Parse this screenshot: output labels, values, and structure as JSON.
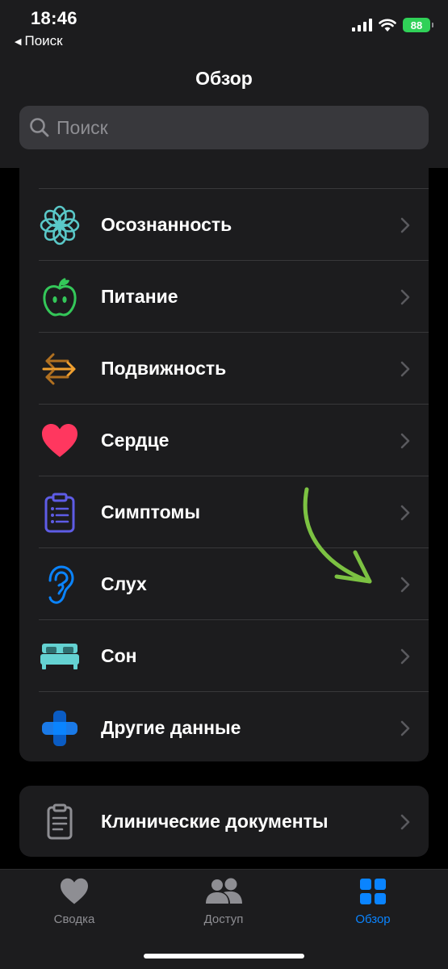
{
  "status": {
    "time": "18:46",
    "back_label": "Поиск",
    "battery": "88"
  },
  "header": {
    "title": "Обзор",
    "search_placeholder": "Поиск"
  },
  "categories": [
    {
      "label": "Осознанность",
      "icon": "mindfulness-icon",
      "color": "#5ac8c8"
    },
    {
      "label": "Питание",
      "icon": "apple-icon",
      "color": "#34c759"
    },
    {
      "label": "Подвижность",
      "icon": "mobility-arrows-icon",
      "color": "#f0a030"
    },
    {
      "label": "Сердце",
      "icon": "heart-icon",
      "color": "#ff375f"
    },
    {
      "label": "Симптомы",
      "icon": "clipboard-list-icon",
      "color": "#5e5ce6"
    },
    {
      "label": "Слух",
      "icon": "ear-icon",
      "color": "#0a84ff"
    },
    {
      "label": "Сон",
      "icon": "bed-icon",
      "color": "#64d2d2"
    },
    {
      "label": "Другие данные",
      "icon": "plus-icon",
      "color": "#0a84ff"
    }
  ],
  "clinical": {
    "label": "Клинические документы",
    "icon": "document-icon"
  },
  "annotation": {
    "color": "#7cc242"
  },
  "tabbar": {
    "tabs": [
      {
        "label": "Сводка",
        "icon": "heart-icon",
        "active": false
      },
      {
        "label": "Доступ",
        "icon": "people-icon",
        "active": false
      },
      {
        "label": "Обзор",
        "icon": "grid-icon",
        "active": true
      }
    ]
  }
}
